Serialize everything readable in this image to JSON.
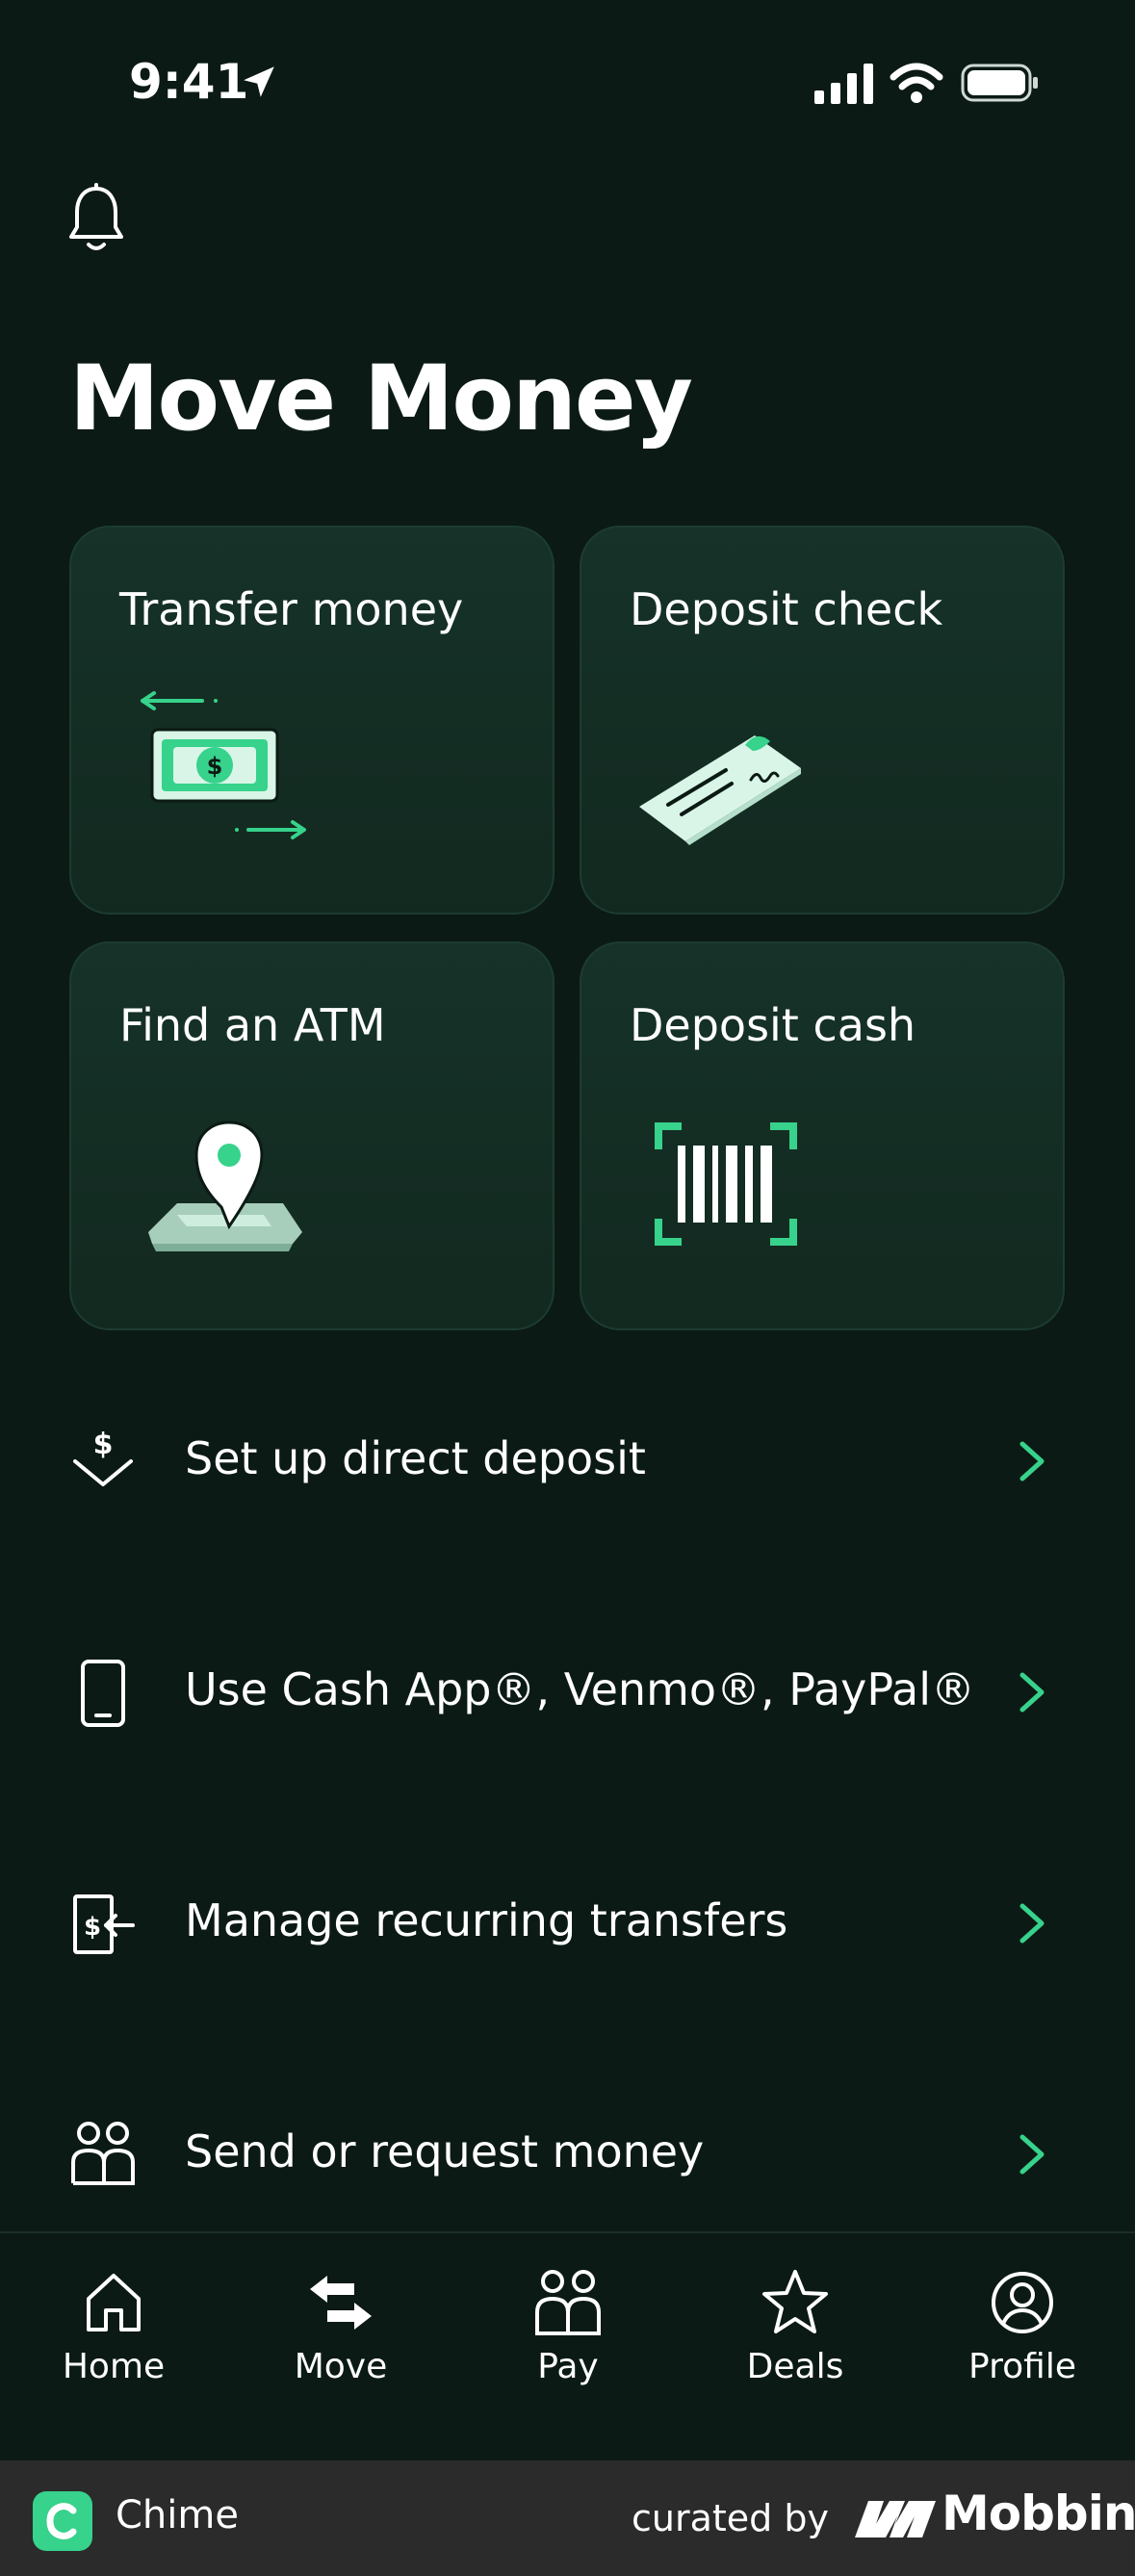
{
  "status_bar": {
    "time": "9:41",
    "icons": [
      "location-arrow-icon",
      "signal-icon",
      "wifi-icon",
      "battery-icon"
    ]
  },
  "header": {
    "icon": "bell-icon",
    "title": "Move Money"
  },
  "cards": [
    {
      "label": "Transfer money",
      "icon": "cash-transfer-icon"
    },
    {
      "label": "Deposit check",
      "icon": "check-icon"
    },
    {
      "label": "Find an ATM",
      "icon": "map-pin-icon"
    },
    {
      "label": "Deposit cash",
      "icon": "barcode-icon"
    }
  ],
  "list": [
    {
      "label": "Set up direct deposit",
      "icon": "direct-deposit-icon"
    },
    {
      "label": "Use Cash App®, Venmo®, PayPal®",
      "icon": "phone-icon"
    },
    {
      "label": "Manage recurring transfers",
      "icon": "recurring-transfer-icon"
    },
    {
      "label": "Send or request money",
      "icon": "people-icon"
    }
  ],
  "tabs": [
    {
      "label": "Home",
      "icon": "home-icon"
    },
    {
      "label": "Move",
      "icon": "move-arrows-icon"
    },
    {
      "label": "Pay",
      "icon": "pay-people-icon"
    },
    {
      "label": "Deals",
      "icon": "star-icon"
    },
    {
      "label": "Profile",
      "icon": "profile-icon"
    }
  ],
  "footer": {
    "app_name": "Chime",
    "curated_by": "curated by",
    "brand": "Mobbin"
  },
  "colors": {
    "background": "#0b1a14",
    "card": "#14302a",
    "accent": "#37d28b"
  }
}
